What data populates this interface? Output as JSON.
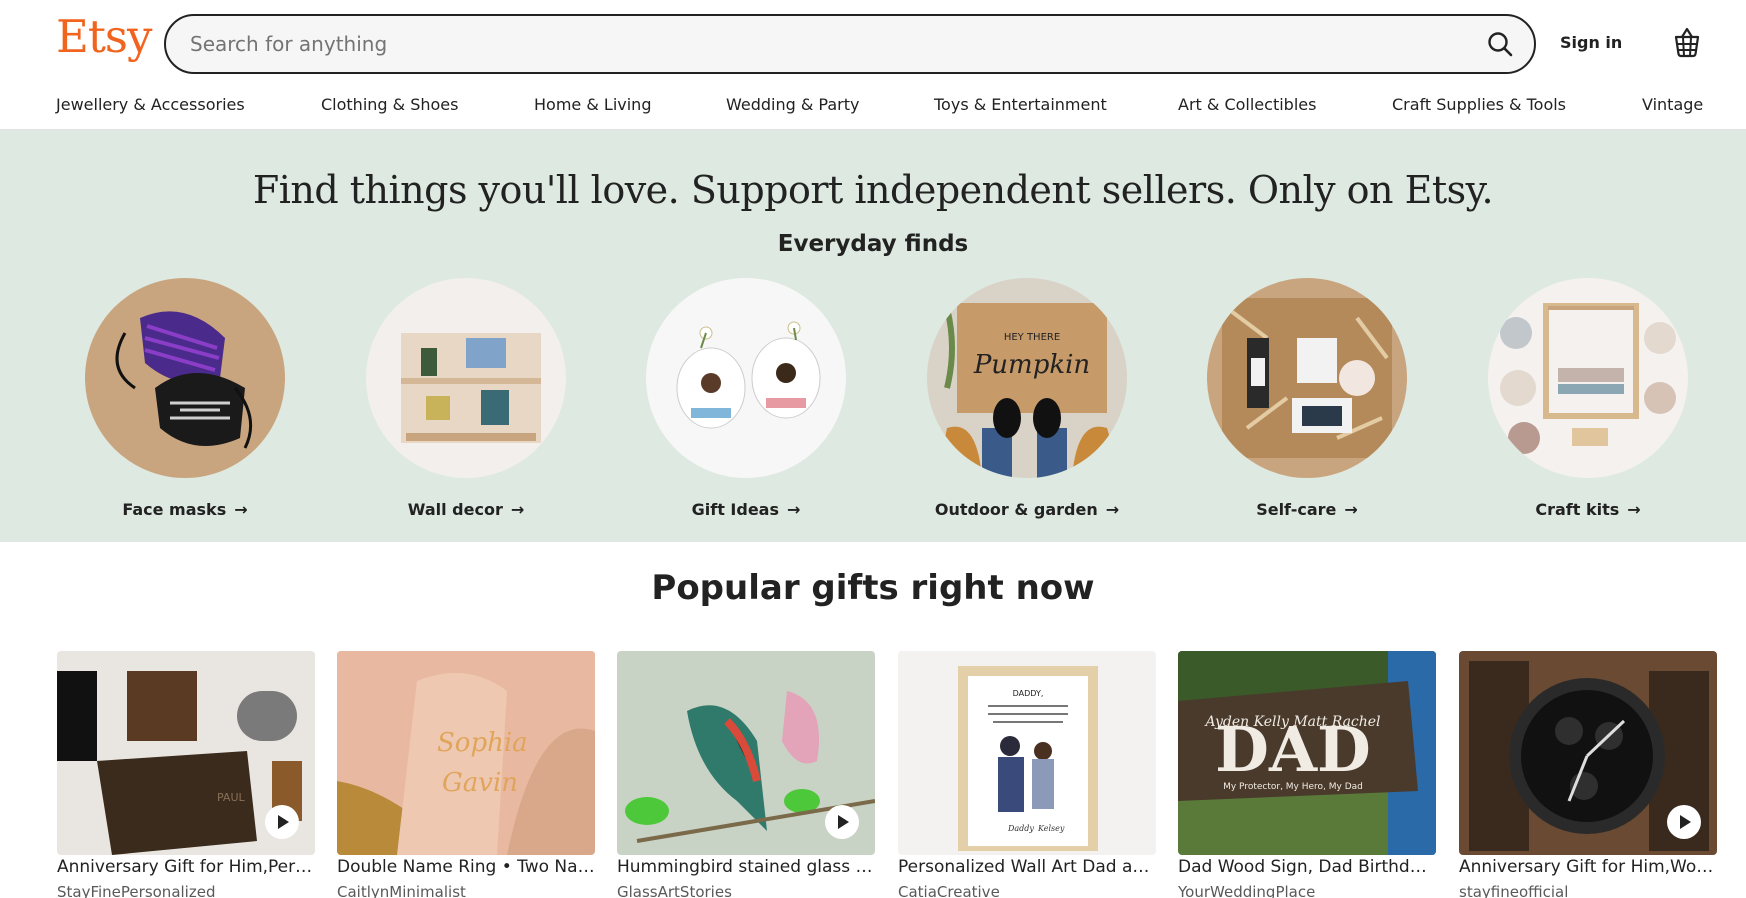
{
  "header": {
    "logo": "Etsy",
    "search_placeholder": "Search for anything",
    "search_icon": "search-icon",
    "signin_label": "Sign in",
    "cart_icon": "shopping-basket-icon"
  },
  "categories": [
    "Jewellery & Accessories",
    "Clothing & Shoes",
    "Home & Living",
    "Wedding & Party",
    "Toys & Entertainment",
    "Art & Collectibles",
    "Craft Supplies & Tools",
    "Vintage"
  ],
  "hero": {
    "title": "Find things you'll love. Support independent sellers. Only on Etsy.",
    "subtitle": "Everyday finds",
    "items": [
      {
        "label": "Face masks",
        "arrow": "→"
      },
      {
        "label": "Wall decor",
        "arrow": "→"
      },
      {
        "label": "Gift Ideas",
        "arrow": "→"
      },
      {
        "label": "Outdoor & garden",
        "arrow": "→"
      },
      {
        "label": "Self-care",
        "arrow": "→"
      },
      {
        "label": "Craft kits",
        "arrow": "→"
      }
    ]
  },
  "popular": {
    "title": "Popular gifts right now",
    "items": [
      {
        "title": "Anniversary Gift for Him,Personalized Wallet",
        "shop": "StayFinePersonalized",
        "has_video": true
      },
      {
        "title": "Double Name Ring • Two Name Ring",
        "shop": "CaitlynMinimalist",
        "has_video": false
      },
      {
        "title": "Hummingbird stained glass suncatcher",
        "shop": "GlassArtStories",
        "has_video": true
      },
      {
        "title": "Personalized Wall Art Dad and Daughter",
        "shop": "CatiaCreative",
        "has_video": false
      },
      {
        "title": "Dad Wood Sign, Dad Birthday Gift",
        "shop": "YourWeddingPlace",
        "has_video": false
      },
      {
        "title": "Anniversary Gift for Him,Wooden Watch",
        "shop": "stayfineofficial",
        "has_video": true
      }
    ]
  },
  "colors": {
    "brand": "#F1641E",
    "hero_bg": "#dde9e1",
    "text": "#222222"
  }
}
